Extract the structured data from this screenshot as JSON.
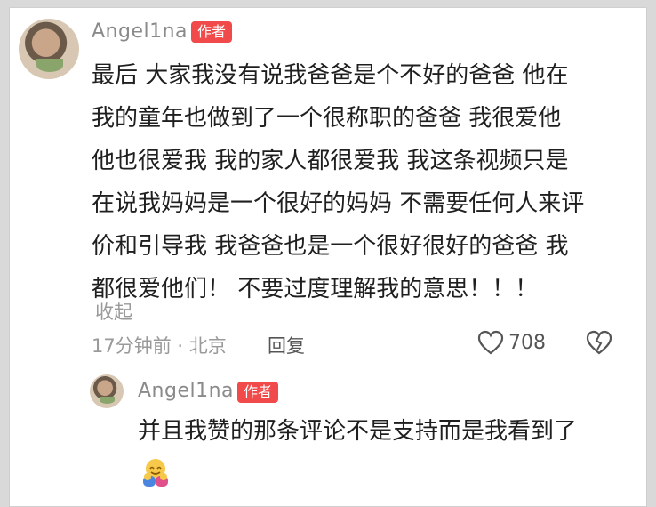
{
  "comment": {
    "username": "Angel1na",
    "badge": "作者",
    "lines": [
      "最后 大家我没有说我爸爸是个不好的爸爸 他在",
      "我的童年也做到了一个很称职的爸爸 我很爱他",
      "他也很爱我 我的家人都很爱我 我这条视频只是",
      "在说我妈妈是一个很好的妈妈 不需要任何人来评",
      "价和引导我 我爸爸也是一个很好很好的爸爸 我",
      "都很爱他们！ 不要过度理解我的意思！！！"
    ],
    "collapse_label": "收起",
    "meta": "17分钟前 · 北京",
    "reply_label": "回复",
    "like_count": "708"
  },
  "reply": {
    "username": "Angel1na",
    "badge": "作者",
    "text": "并且我赞的那条评论不是支持而是我看到了"
  },
  "colors": {
    "badge_bg": "#f04a4a",
    "username": "#8a8a8a",
    "text": "#1f1f1f",
    "meta": "#9a9a9a"
  },
  "icons": [
    "heart-icon",
    "broken-heart-icon",
    "hug-emoji-icon"
  ]
}
